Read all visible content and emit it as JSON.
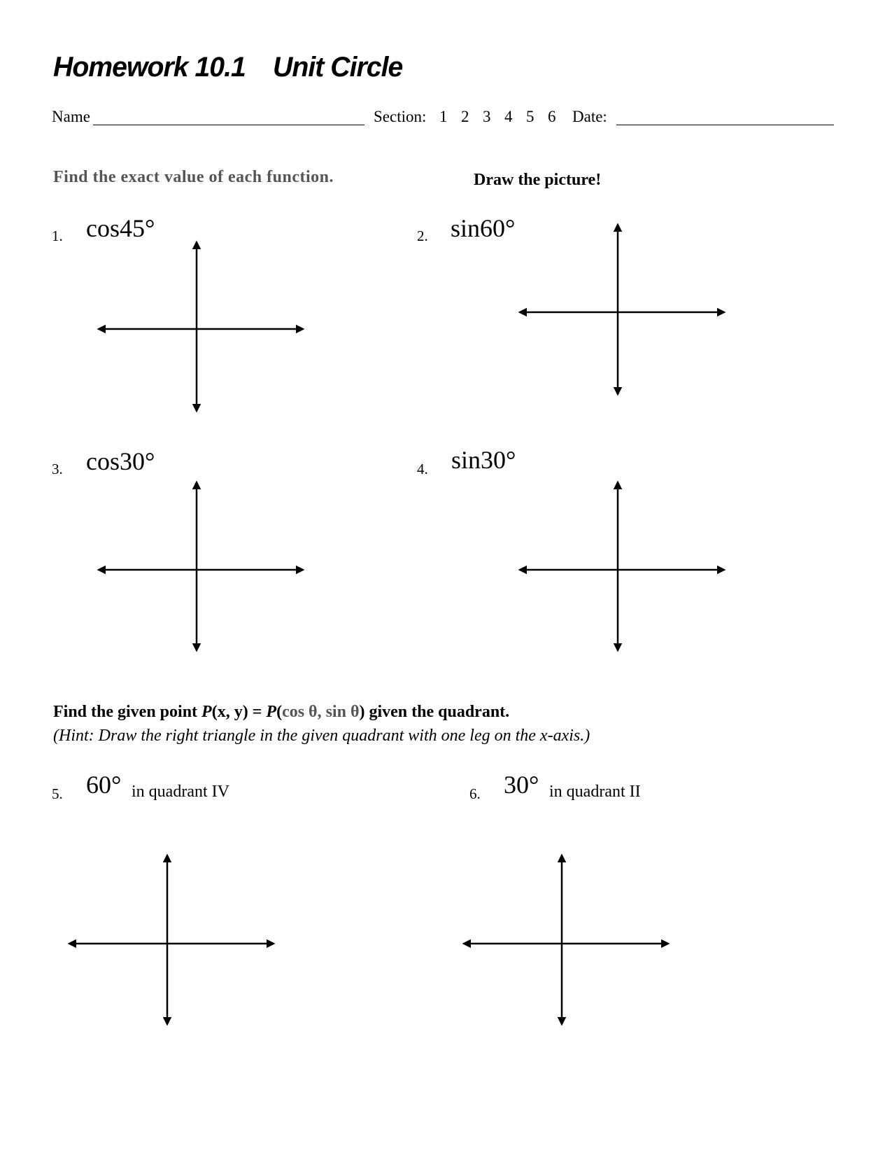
{
  "header": {
    "title_part1": "Homework 10.1",
    "title_part2": "Unit Circle",
    "name_label": "Name",
    "section_label": "Section:",
    "section_options": [
      "1",
      "2",
      "3",
      "4",
      "5",
      "6"
    ],
    "date_label": "Date:"
  },
  "part1": {
    "instruction": "Find the exact value of each function.",
    "draw_instruction": "Draw the picture!",
    "problems": [
      {
        "number": "1.",
        "expression": "cos45°"
      },
      {
        "number": "2.",
        "expression": "sin60°"
      },
      {
        "number": "3.",
        "expression": "cos30°"
      },
      {
        "number": "4.",
        "expression": "sin30°"
      }
    ]
  },
  "part2": {
    "instruction_a": "Find the given point ",
    "instruction_p1": "P",
    "instruction_b": "(x, y) = ",
    "instruction_p2": "P",
    "instruction_c": "(",
    "instruction_trig": "cos θ, sin θ",
    "instruction_d": ") given the quadrant.",
    "hint": "(Hint:  Draw the right triangle in the given quadrant with one leg on the x-axis.)",
    "problems": [
      {
        "number": "5.",
        "angle": "60°",
        "quadrant_text": "in quadrant IV"
      },
      {
        "number": "6.",
        "angle": "30°",
        "quadrant_text": "in quadrant II"
      }
    ]
  }
}
